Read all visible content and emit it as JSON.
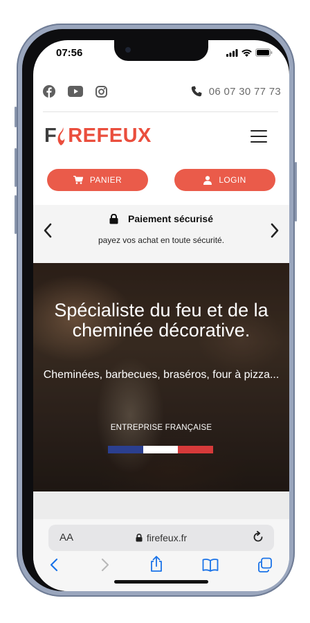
{
  "status_bar": {
    "time": "07:56"
  },
  "top_bar": {
    "social_icons": [
      "facebook-icon",
      "youtube-icon",
      "instagram-icon"
    ],
    "phone_number": "06 07 30 77 73"
  },
  "brand": {
    "logo_part1": "F",
    "logo_part2": "RE",
    "logo_part3": "FEUX"
  },
  "actions": {
    "cart_label": "PANIER",
    "login_label": "LOGIN"
  },
  "promo": {
    "title": "Paiement sécurisé",
    "subtitle": "payez vos achat en toute sécurité."
  },
  "hero": {
    "title": "Spécialiste du feu et de la cheminée décorative.",
    "subtitle": "Cheminées, barbecues, braséros, four à pizza...",
    "tagline": "ENTREPRISE FRANÇAISE",
    "flag_colors": [
      "#2b3f8f",
      "#ffffff",
      "#d63a3a"
    ]
  },
  "browser": {
    "text_size_label": "AA",
    "url": "firefeux.fr"
  },
  "colors": {
    "accent": "#ea5b4a",
    "logo_red": "#ea4e3d",
    "logo_dark": "#3d3d3d"
  }
}
